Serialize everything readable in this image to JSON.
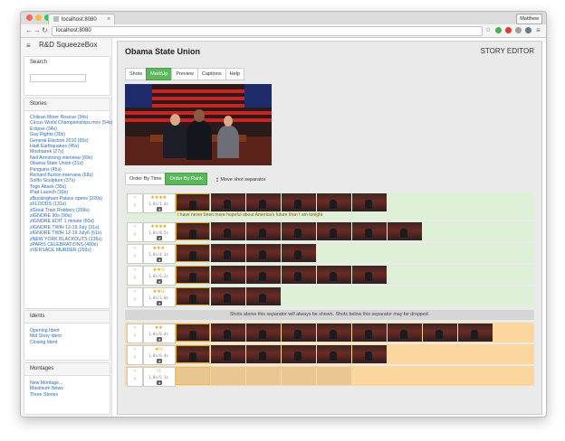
{
  "browser": {
    "tab_title": "localhost:8080",
    "url": "localhost:8080",
    "user": "Matthew",
    "colors": {
      "close": "#fc605b",
      "min": "#fdbc40",
      "max": "#34c84a"
    }
  },
  "app": {
    "title": "R&D SqueezeBox",
    "mode": "STORY EDITOR"
  },
  "sidebar": {
    "search": {
      "heading": "Search",
      "placeholder": ""
    },
    "stories": {
      "heading": "Stories",
      "items": [
        "Chilean Miner Rescue (34s)",
        "Circus World Championships.mov (54s)",
        "Eclipse (34s)",
        "Gay Rights (30s)",
        "General Election 2010 (65s)",
        "Haiti Earthquakes (45s)",
        "Moshtarek (27s)",
        "Neil Armstrong interview (69s)",
        "Obama State Union (31s)",
        "Penguins (45s)",
        "Richard Burton interview (68s)",
        "Sollfo-Sculpture (37s)",
        "Togo Attack (35s)",
        "iPad Launch (16s)",
        "zBuckingham Palace opens (220s)",
        "zFLOODS (131s)",
        "zGreat Train Robbery (209s)",
        "zIGNORE 90s (90s)",
        "zIGNORE EDIT 1 minute (60s)",
        "zIGNORE TWIH 12-19 July (31s)",
        "zIGNORE TWIH 12-19 July6 (61s)",
        "zNEW YORK BLACKOUTS (136s)",
        "zPARIS CELEBRATIONS (400s)",
        "zVERSACE MURDER (293s)"
      ]
    },
    "idents": {
      "heading": "Idents",
      "items": [
        "Opening Ident",
        "Mid Story Ident",
        "Closing Ident"
      ]
    },
    "montages": {
      "heading": "Montages",
      "items": [
        "New Montage...",
        "Maximum News",
        "Three Stories"
      ]
    }
  },
  "editor": {
    "title": "Obama State Union",
    "tabs": [
      {
        "label": "Shots",
        "active": false
      },
      {
        "label": "MarkUp",
        "active": true
      },
      {
        "label": "Preview",
        "active": false
      },
      {
        "label": "Captions",
        "active": false
      },
      {
        "label": "Help",
        "active": false
      }
    ],
    "order_by_time": "Order By Time",
    "order_by_rank": "Order By Rank",
    "move_separator_hint": "Move shot separator",
    "separator_text": "Shots above this separator will always be shown. Shots below this separator may be dropped.",
    "up_label": "↑",
    "down_label": "↓",
    "shots_above": [
      {
        "stars": "★★★★",
        "duration": "1.0s/1.4s",
        "frames": 6,
        "caption": "I have never been more hopeful about America's future than I am tonight"
      },
      {
        "stars": "★★★★",
        "duration": "1.0s/8.5s",
        "frames": 7,
        "caption": ""
      },
      {
        "stars": "★★★",
        "duration": "1.0s/4.1s",
        "frames": 4,
        "caption": ""
      },
      {
        "stars": "★★½",
        "duration": "1.0s/6.2s",
        "frames": 6,
        "caption": ""
      },
      {
        "stars": "★★½",
        "duration": "1.0s/3.0s",
        "frames": 3,
        "caption": ""
      }
    ],
    "shots_below": [
      {
        "stars": "★★",
        "duration": "1.0s/8.4s",
        "frames": 9
      },
      {
        "stars": "★½",
        "duration": "1.0s/6.4s",
        "frames": 6
      },
      {
        "stars": "½",
        "duration": "1.0s/5.1s",
        "frames": 5
      }
    ]
  }
}
